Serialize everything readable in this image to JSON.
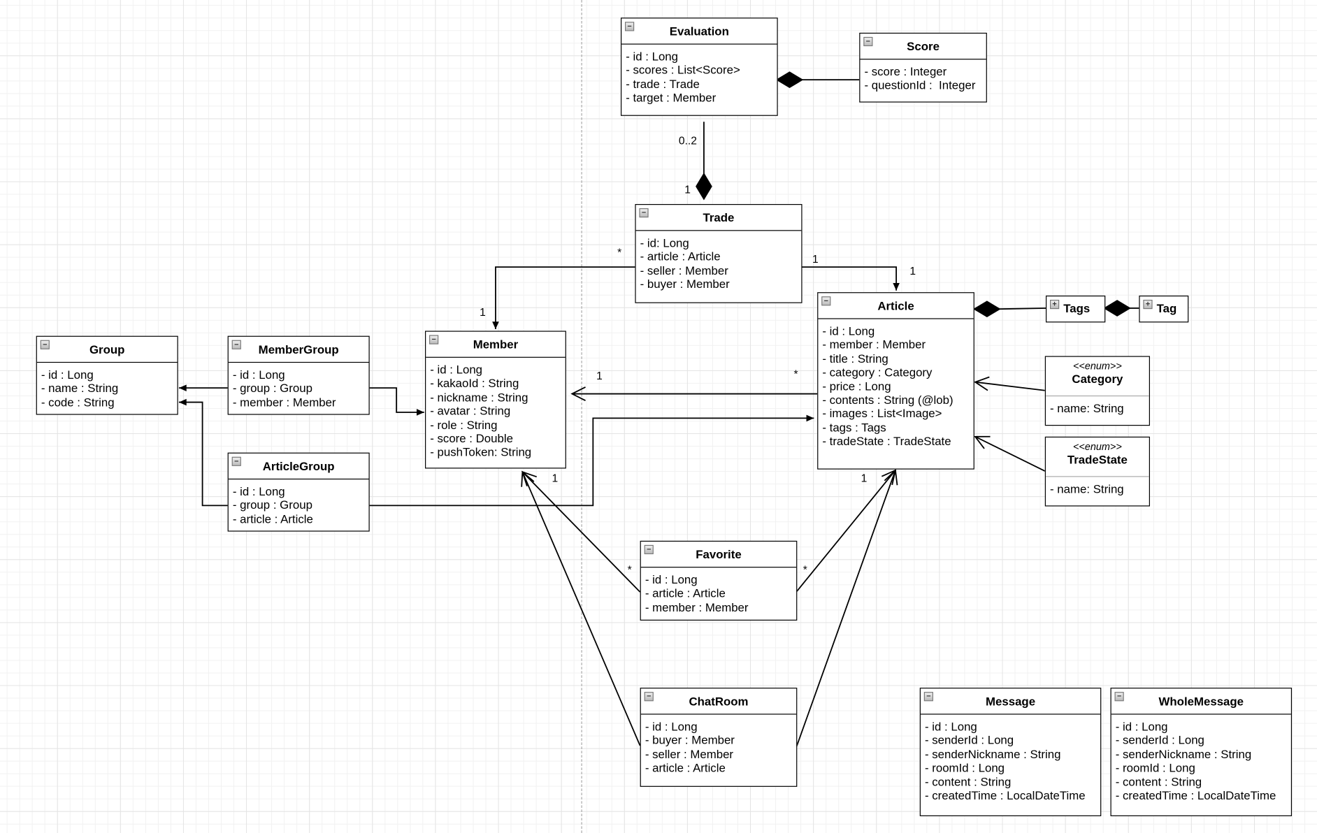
{
  "classes": [
    {
      "id": "evaluation",
      "name": "Evaluation",
      "toggle": "minus",
      "fields": [
        "- id : Long",
        "- scores : List<Score>",
        "- trade : Trade",
        "- target : Member"
      ]
    },
    {
      "id": "score",
      "name": "Score",
      "toggle": "minus",
      "fields": [
        "- score : Integer",
        "- questionId :  Integer"
      ]
    },
    {
      "id": "trade",
      "name": "Trade",
      "toggle": "minus",
      "fields": [
        "- id: Long",
        "- article : Article",
        "- seller : Member",
        "- buyer : Member"
      ]
    },
    {
      "id": "article",
      "name": "Article",
      "toggle": "minus",
      "fields": [
        "- id : Long",
        "- member : Member",
        "- title : String",
        "- category : Category",
        "- price : Long",
        "- contents : String (@lob)",
        "- images : List<Image>",
        "- tags : Tags",
        "- tradeState : TradeState"
      ]
    },
    {
      "id": "tags",
      "name": "Tags",
      "toggle": "plus",
      "fields": []
    },
    {
      "id": "tag",
      "name": "Tag",
      "toggle": "plus",
      "fields": []
    },
    {
      "id": "category",
      "name": "Category",
      "stereotype": "<<enum>>",
      "fields": [
        "- name: String"
      ]
    },
    {
      "id": "tradestate",
      "name": "TradeState",
      "stereotype": "<<enum>>",
      "fields": [
        "- name: String"
      ]
    },
    {
      "id": "member",
      "name": "Member",
      "toggle": "minus",
      "fields": [
        "- id : Long",
        "- kakaoId : String",
        "- nickname : String",
        "- avatar : String",
        "- role : String",
        "- score : Double",
        "- pushToken: String"
      ]
    },
    {
      "id": "group",
      "name": "Group",
      "toggle": "minus",
      "fields": [
        "- id : Long",
        "- name : String",
        "- code : String"
      ]
    },
    {
      "id": "membergroup",
      "name": "MemberGroup",
      "toggle": "minus",
      "fields": [
        "- id : Long",
        "- group : Group",
        "- member : Member"
      ]
    },
    {
      "id": "articlegroup",
      "name": "ArticleGroup",
      "toggle": "minus",
      "fields": [
        "- id : Long",
        "- group : Group",
        "- article : Article"
      ]
    },
    {
      "id": "favorite",
      "name": "Favorite",
      "toggle": "minus",
      "fields": [
        "- id : Long",
        "- article : Article",
        "- member : Member"
      ]
    },
    {
      "id": "chatroom",
      "name": "ChatRoom",
      "toggle": "minus",
      "fields": [
        "- id : Long",
        "- buyer : Member",
        "- seller : Member",
        "- article : Article"
      ]
    },
    {
      "id": "message",
      "name": "Message",
      "toggle": "minus",
      "fields": [
        "- id : Long",
        "- senderId : Long",
        "- senderNickname : String",
        "- roomId : Long",
        "- content : String",
        "- createdTime : LocalDateTime"
      ]
    },
    {
      "id": "wholemessage",
      "name": "WholeMessage",
      "toggle": "minus",
      "fields": [
        "- id : Long",
        "- senderId : Long",
        "- senderNickname : String",
        "- roomId : Long",
        "- content : String",
        "- createdTime : LocalDateTime"
      ]
    }
  ],
  "multiplicities": {
    "evaluation_trade_eval": "0..2",
    "evaluation_trade_trade": "1",
    "trade_member_trade": "*",
    "trade_member_member": "1",
    "trade_article_trade": "1",
    "trade_article_article": "1",
    "article_member_member": "1",
    "article_member_article": "*",
    "favorite_member_fav": "*",
    "favorite_member_member": "1",
    "favorite_article_fav": "*",
    "favorite_article_article": "1"
  }
}
